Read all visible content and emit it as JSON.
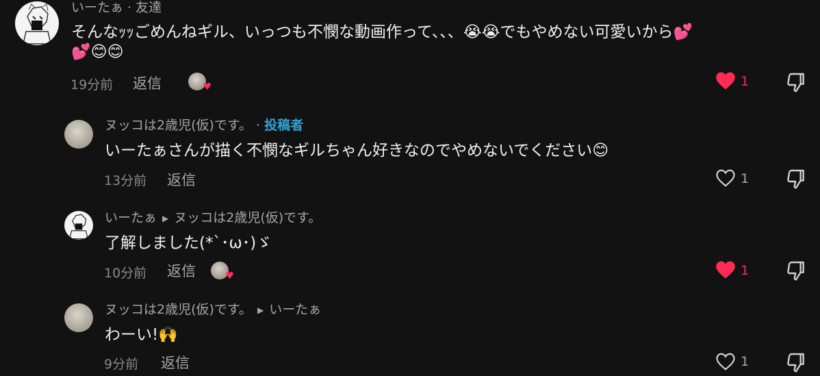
{
  "colors": {
    "accent_heart": "#fe2c55",
    "creator_tag": "#2fa3d6",
    "background": "#121212"
  },
  "comments": [
    {
      "username": "いーたぁ",
      "relation": " · 友達",
      "text_line1": "そんなｯｯごめんねギル、いっつも不憫な動画作って、、、😭😭でもやめない可愛いから💕",
      "text_line2": "💕😊😊",
      "time": "19分前",
      "reply_label": "返信",
      "like_count": "1",
      "liked": true,
      "creator_liked": true
    },
    {
      "username": "ヌッコは2歳児(仮)です。",
      "separator": " · ",
      "creator_label": "投稿者",
      "text": "いーたぁさんが描く不憫なギルちゃん好きなのでやめないでください😊",
      "time": "13分前",
      "reply_label": "返信",
      "like_count": "1",
      "liked": false
    },
    {
      "username": "いーたぁ",
      "reply_to": "ヌッコは2歳児(仮)です。",
      "text": "了解しました(*`･ω･)ゞ",
      "time": "10分前",
      "reply_label": "返信",
      "like_count": "1",
      "liked": true,
      "creator_liked": true
    },
    {
      "username": "ヌッコは2歳児(仮)です。",
      "reply_to": "いーたぁ",
      "text": "わーい!🙌",
      "time": "9分前",
      "reply_label": "返信",
      "like_count": "1",
      "liked": false
    }
  ]
}
